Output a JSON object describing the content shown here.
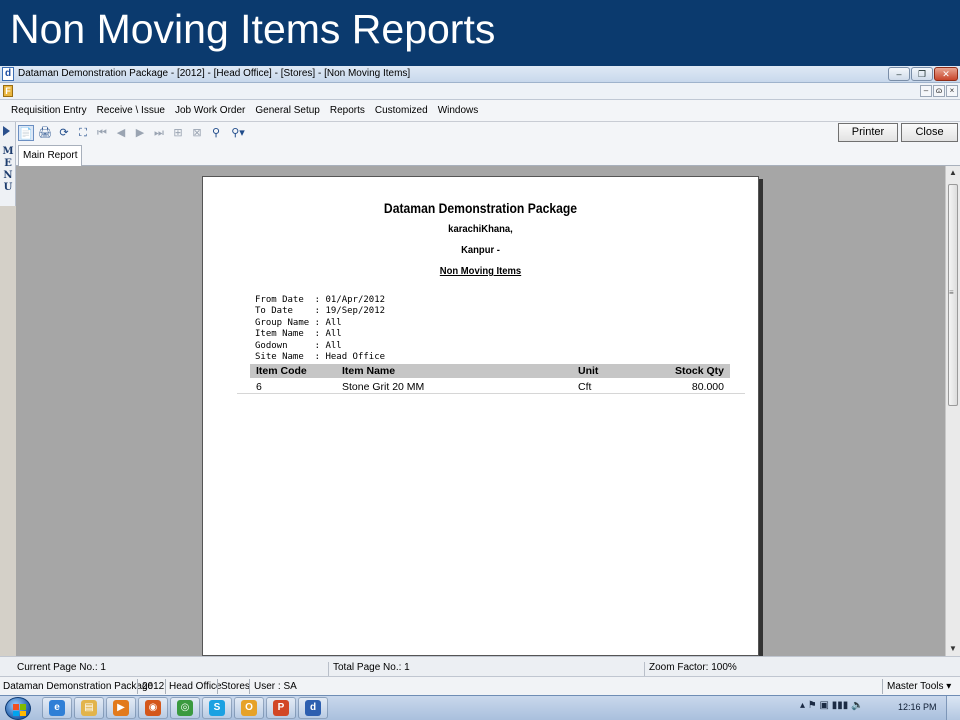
{
  "slide": {
    "title": "Non Moving Items Reports"
  },
  "window": {
    "app_icon": "d",
    "title": "Dataman Demonstration Package - [2012] - [Head Office] - [Stores] - [Non Moving Items]",
    "controls": {
      "minimize": "‒",
      "maximize": "❐",
      "close": "✕"
    }
  },
  "mdi": {
    "icon": "F",
    "controls": {
      "minimize": "–",
      "restore": "ɷ",
      "close": "×"
    }
  },
  "menu": {
    "items": [
      {
        "label": "Requisition Entry"
      },
      {
        "label": "Receive \\ Issue"
      },
      {
        "label": "Job Work Order"
      },
      {
        "label": "General Setup"
      },
      {
        "label": "Reports"
      },
      {
        "label": "Customized"
      },
      {
        "label": "Windows"
      }
    ]
  },
  "side_menu": {
    "label": "MENU"
  },
  "toolbar": {
    "icons": [
      {
        "name": "export-icon",
        "glyph": "📄"
      },
      {
        "name": "print-icon",
        "glyph": "🖨"
      },
      {
        "name": "refresh-icon",
        "glyph": "⟳"
      },
      {
        "name": "tree-icon",
        "glyph": "⛶"
      },
      {
        "name": "first-page-icon",
        "glyph": "⏮"
      },
      {
        "name": "previous-page-icon",
        "glyph": "◀"
      },
      {
        "name": "next-page-icon",
        "glyph": "▶"
      },
      {
        "name": "last-page-icon",
        "glyph": "⏭"
      },
      {
        "name": "goto-page-icon",
        "glyph": "⊞"
      },
      {
        "name": "stop-icon",
        "glyph": "⊠"
      },
      {
        "name": "search-icon",
        "glyph": "⚲"
      },
      {
        "name": "zoom-icon",
        "glyph": "⚲▾"
      }
    ],
    "printer_label": "Printer",
    "close_label": "Close"
  },
  "tabs": [
    {
      "label": "Main Report"
    }
  ],
  "report": {
    "company": "Dataman Demonstration Package",
    "line2": "karachiKhana,",
    "line3": "Kanpur -",
    "title": "Non Moving Items",
    "filters": [
      {
        "label": "From Date  ",
        "value": "01/Apr/2012"
      },
      {
        "label": "To Date    ",
        "value": "19/Sep/2012"
      },
      {
        "label": "Group Name ",
        "value": "All"
      },
      {
        "label": "Item Name  ",
        "value": "All"
      },
      {
        "label": "Godown     ",
        "value": "All"
      },
      {
        "label": "Site Name  ",
        "value": "Head Office"
      }
    ],
    "columns": {
      "code": "Item Code",
      "name": "Item Name",
      "unit": "Unit",
      "qty": "Stock Qty"
    },
    "rows": [
      {
        "code": "6",
        "name": "Stone Grit 20 MM",
        "unit": "Cft",
        "qty": "80.000"
      }
    ]
  },
  "status": {
    "current_page": "Current Page No.: 1",
    "total_page": "Total Page No.: 1",
    "zoom": "Zoom Factor: 100%"
  },
  "info": {
    "app": "Dataman Demonstration Package",
    "year": "2012",
    "site": "Head Office",
    "dept": "Stores",
    "user": "User : SA",
    "master_tools": "Master Tools  ▾"
  },
  "taskbar": {
    "apps": [
      {
        "name": "ie",
        "glyph": "e",
        "color": "#2f7fd6"
      },
      {
        "name": "explorer",
        "glyph": "▤",
        "color": "#e2b44c"
      },
      {
        "name": "media-player",
        "glyph": "▶",
        "color": "#e27a1c"
      },
      {
        "name": "firefox",
        "glyph": "◉",
        "color": "#d4571b"
      },
      {
        "name": "chrome",
        "glyph": "◎",
        "color": "#3b9a3f"
      },
      {
        "name": "skype",
        "glyph": "S",
        "color": "#1ba1e2"
      },
      {
        "name": "outlook",
        "glyph": "O",
        "color": "#e6a229"
      },
      {
        "name": "powerpoint",
        "glyph": "P",
        "color": "#d24726"
      },
      {
        "name": "dataman",
        "glyph": "d",
        "color": "#2d5fb0"
      }
    ],
    "tray": "▴  ⚑  ▣  ▮▮▮  🔈",
    "clock": "12:16 PM"
  }
}
